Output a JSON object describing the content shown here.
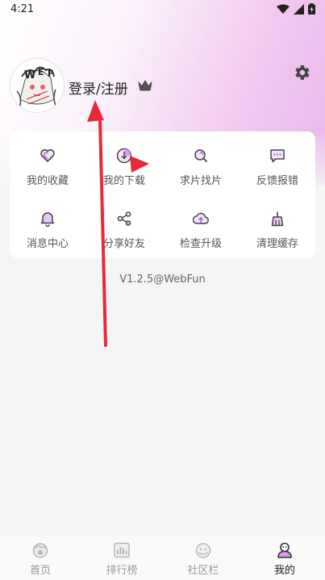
{
  "status_bar": {
    "time": "4:21",
    "icons": [
      "wifi-icon",
      "signal-icon",
      "battery-charging-icon"
    ]
  },
  "profile": {
    "avatar_icon": "avatar",
    "login_label": "登录/注册",
    "vip_icon": "crown-icon",
    "settings_icon": "gear-icon"
  },
  "menu": {
    "items": [
      {
        "label": "我的收藏",
        "icon": "heart-icon"
      },
      {
        "label": "我的下载",
        "icon": "download-icon"
      },
      {
        "label": "求片找片",
        "icon": "search-film-icon"
      },
      {
        "label": "反馈报错",
        "icon": "feedback-icon"
      },
      {
        "label": "消息中心",
        "icon": "bell-icon"
      },
      {
        "label": "分享好友",
        "icon": "share-icon"
      },
      {
        "label": "检查升级",
        "icon": "upgrade-icon"
      },
      {
        "label": "清理缓存",
        "icon": "broom-icon"
      }
    ]
  },
  "version": "V1.2.5@WebFun",
  "tabbar": {
    "tabs": [
      {
        "label": "首页",
        "icon": "home-icon",
        "active": false
      },
      {
        "label": "排行榜",
        "icon": "ranking-icon",
        "active": false
      },
      {
        "label": "社区栏",
        "icon": "community-icon",
        "active": false
      },
      {
        "label": "我的",
        "icon": "profile-icon",
        "active": true
      }
    ]
  },
  "colors": {
    "accent": "#b05fd8",
    "header_gradient_end": "#eab6ea",
    "annotation_arrow": "#e8283c"
  }
}
